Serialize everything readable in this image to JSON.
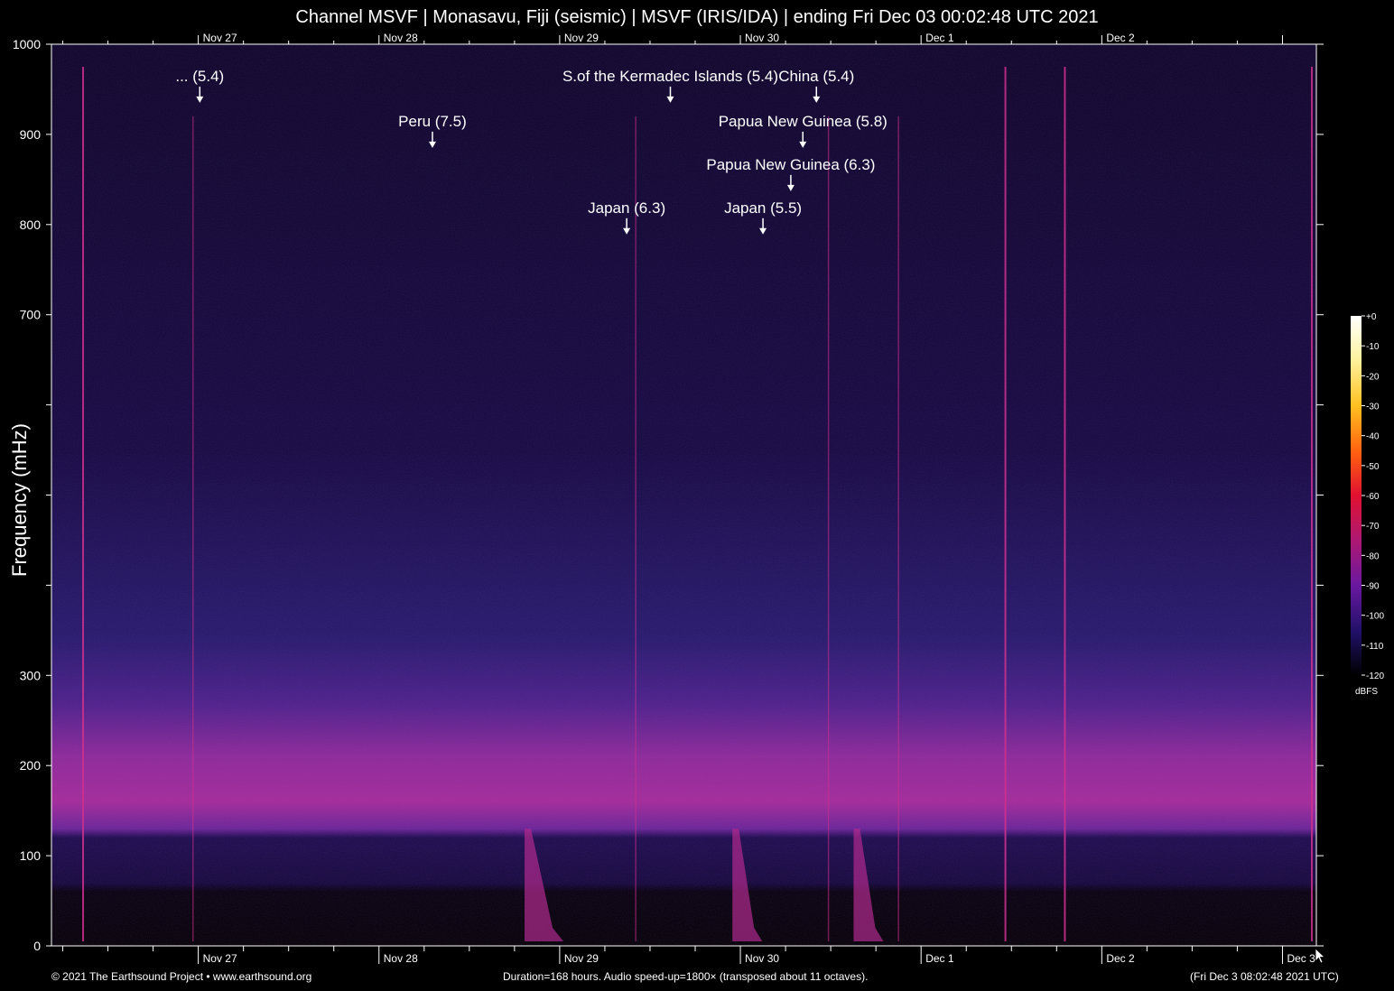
{
  "title": "Channel MSVF | Monasavu, Fiji (seismic) | MSVF (IRIS/IDA) | ending Fri Dec 03 00:02:48 UTC 2021",
  "footer": {
    "left": "© 2021 The Earthsound Project • www.earthsound.org",
    "center": "Duration=168 hours. Audio speed-up=1800× (transposed about 11 octaves).",
    "right": "(Fri Dec  3 08:02:48 2021 UTC)"
  },
  "colors": {
    "background": "#000000",
    "spectrogram_base": "#0a0628",
    "noise_band": "#b0289a",
    "event_line": "#d0308f"
  },
  "chart_data": {
    "type": "heatmap",
    "ylabel": "Frequency (mHz)",
    "ylim": [
      0,
      1000
    ],
    "yticks": [
      0,
      100,
      200,
      300,
      400,
      500,
      600,
      700,
      800,
      900,
      1000
    ],
    "ytick_labels": [
      "0",
      "100",
      "200",
      "300",
      "",
      "",
      "",
      "700",
      "800",
      "900",
      "1000"
    ],
    "x_unit": "hours",
    "xlim": [
      0,
      168
    ],
    "x_date_ticks_bottom": [
      {
        "label": "Nov 27",
        "hour": 19.5
      },
      {
        "label": "Nov 28",
        "hour": 43.5
      },
      {
        "label": "Nov 29",
        "hour": 67.5
      },
      {
        "label": "Nov 30",
        "hour": 91.5
      },
      {
        "label": "Dec  1",
        "hour": 115.5
      },
      {
        "label": "Dec  2",
        "hour": 139.5
      },
      {
        "label": "Dec  3",
        "hour": 163.5
      }
    ],
    "x_date_ticks_top": [
      {
        "label": "Nov 27",
        "hour": 19.5
      },
      {
        "label": "Nov 28",
        "hour": 43.5
      },
      {
        "label": "Nov 29",
        "hour": 67.5
      },
      {
        "label": "Nov 30",
        "hour": 91.5
      },
      {
        "label": "Dec  1",
        "hour": 115.5
      },
      {
        "label": "Dec  2",
        "hour": 139.5
      }
    ],
    "annotations": [
      {
        "label": "... (5.4)",
        "hour": 19.7,
        "freq": 935
      },
      {
        "label": "Peru (7.5)",
        "hour": 50.6,
        "freq": 885
      },
      {
        "label": "S.of the Kermadec Islands (5.4)",
        "hour": 82.2,
        "freq": 935
      },
      {
        "label": "China (5.4)",
        "hour": 101.6,
        "freq": 935
      },
      {
        "label": "Papua New Guinea (5.8)",
        "hour": 99.8,
        "freq": 885
      },
      {
        "label": "Papua New Guinea (6.3)",
        "hour": 98.2,
        "freq": 837
      },
      {
        "label": "Japan (6.3)",
        "hour": 76.4,
        "freq": 789
      },
      {
        "label": "Japan (5.5)",
        "hour": 94.5,
        "freq": 789
      }
    ],
    "colorbar": {
      "unit": "dBFS",
      "min": -120,
      "max": 0,
      "tick_labels": [
        "+0",
        "-10",
        "-20",
        "-30",
        "-40",
        "-50",
        "-60",
        "-70",
        "-80",
        "-90",
        "-100",
        "-110",
        "-120"
      ]
    },
    "event_lines_hours": [
      4.2,
      18.8,
      77.6,
      103.2,
      112.5,
      126.7,
      134.6,
      167.4
    ]
  }
}
